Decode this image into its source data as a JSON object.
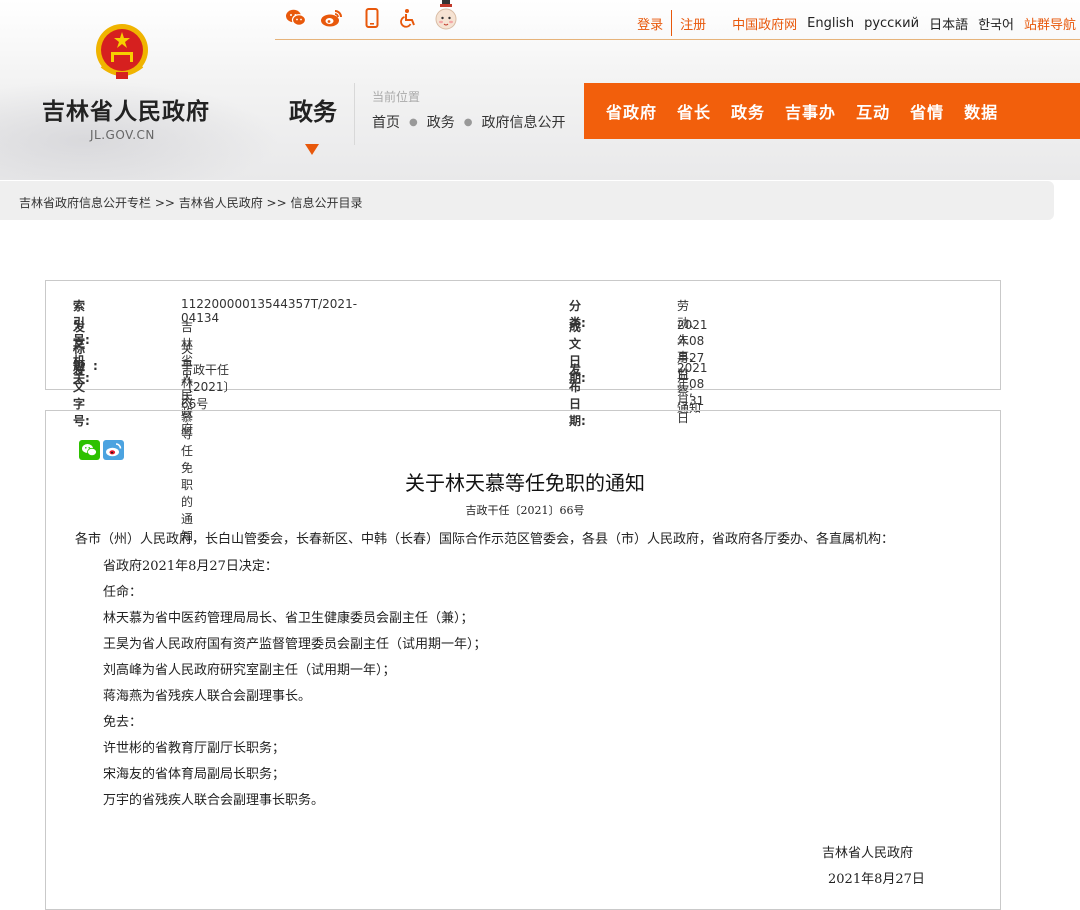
{
  "top_bar": {
    "icons": [
      "wechat-icon",
      "weibo-icon",
      "mobile-icon",
      "accessibility-icon",
      "mascot-icon"
    ],
    "login": "登录",
    "register": "注册",
    "links": [
      "中国政府网",
      "English",
      "русский",
      "日本語",
      "한국어",
      "站群导航"
    ]
  },
  "logo": {
    "name": "吉林省人民政府",
    "domain": "JL.GOV.CN"
  },
  "section": {
    "title": "政务",
    "location_label": "当前位置",
    "path": [
      "首页",
      "政务",
      "政府信息公开"
    ]
  },
  "main_nav": [
    "省政府",
    "省长",
    "政务",
    "吉事办",
    "互动",
    "省情",
    "数据"
  ],
  "breadcrumb": "吉林省政府信息公开专栏 >> 吉林省人民政府 >> 信息公开目录",
  "meta": {
    "index_key": "索 引 号:",
    "index_val": "11220000013544357T/2021-04134",
    "category_key": "分 类:",
    "category_val": "劳动、人事、监察;通知",
    "issuer_key": "发文机关:",
    "issuer_val": "吉林省人民政府",
    "written_key": "成文日期:",
    "written_val": "2021年08月27日",
    "title_key": "标 题:",
    "title_val": "关于林天慕等任免职的通知",
    "docno_key": "发文字号:",
    "docno_val": "吉政干任〔2021〕66号",
    "published_key": "发布日期:",
    "published_val": "2021年08月31日"
  },
  "article": {
    "title": "关于林天慕等任免职的通知",
    "doc_number": "吉政干任〔2021〕66号",
    "addressee": "各市（州）人民政府，长白山管委会，长春新区、中韩（长春）国际合作示范区管委会，各县（市）人民政府，省政府各厅委办、各直属机构：",
    "lines": [
      "省政府2021年8月27日决定：",
      "任命：",
      "林天慕为省中医药管理局局长、省卫生健康委员会副主任（兼）；",
      "王昊为省人民政府国有资产监督管理委员会副主任（试用期一年）；",
      "刘高峰为省人民政府研究室副主任（试用期一年）；",
      "蒋海燕为省残疾人联合会副理事长。",
      "免去：",
      "许世彬的省教育厅副厅长职务；",
      "宋海友的省体育局副局长职务；",
      "万宇的省残疾人联合会副理事长职务。"
    ],
    "signature": "吉林省人民政府",
    "date": "2021年8月27日"
  },
  "colors": {
    "accent": "#f25f0c",
    "link_orange": "#e8580b",
    "wechat": "#2dc100",
    "weibo": "#e6162d"
  }
}
